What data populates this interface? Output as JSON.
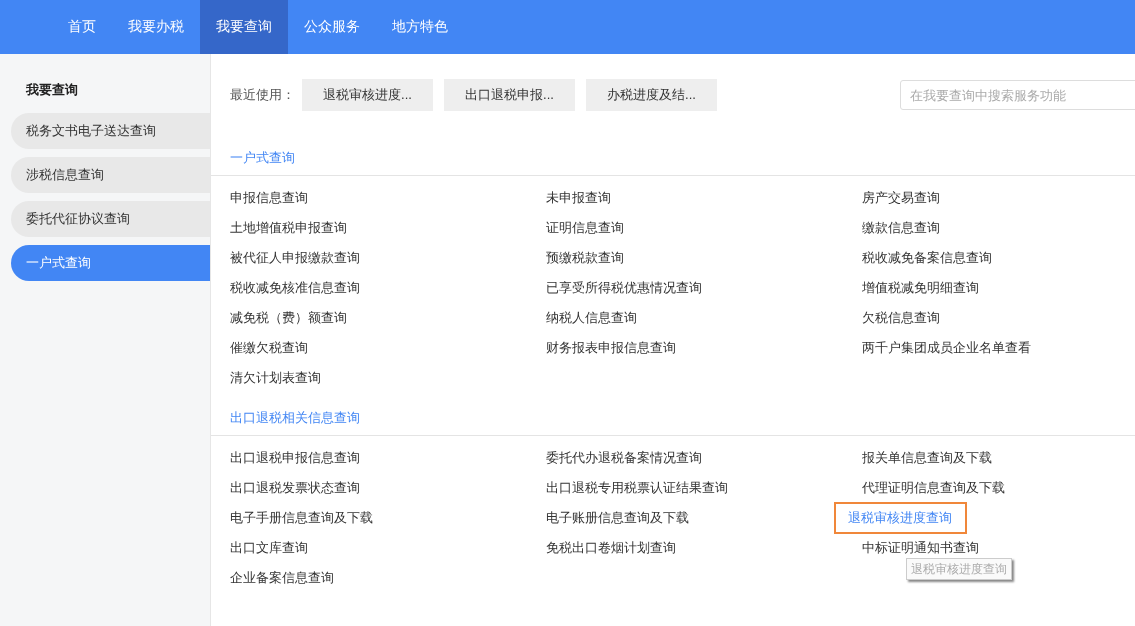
{
  "nav": [
    {
      "label": "首页",
      "selected": false
    },
    {
      "label": "我要办税",
      "selected": false
    },
    {
      "label": "我要查询",
      "selected": true
    },
    {
      "label": "公众服务",
      "selected": false
    },
    {
      "label": "地方特色",
      "selected": false
    }
  ],
  "sidebar": {
    "title": "我要查询",
    "items": [
      {
        "label": "税务文书电子送达查询",
        "selected": false
      },
      {
        "label": "涉税信息查询",
        "selected": false
      },
      {
        "label": "委托代征协议查询",
        "selected": false
      },
      {
        "label": "一户式查询",
        "selected": true
      }
    ]
  },
  "recent": {
    "label": "最近使用：",
    "buttons": [
      "退税审核进度...",
      "出口退税申报...",
      "办税进度及结..."
    ]
  },
  "search": {
    "placeholder": "在我要查询中搜索服务功能"
  },
  "sections": [
    {
      "title": "一户式查询",
      "rows": [
        [
          {
            "label": "申报信息查询",
            "highlighted": false
          },
          {
            "label": "未申报查询",
            "highlighted": false
          },
          {
            "label": "房产交易查询",
            "highlighted": false
          }
        ],
        [
          {
            "label": "土地增值税申报查询",
            "highlighted": false
          },
          {
            "label": "证明信息查询",
            "highlighted": false
          },
          {
            "label": "缴款信息查询",
            "highlighted": false
          }
        ],
        [
          {
            "label": "被代征人申报缴款查询",
            "highlighted": false
          },
          {
            "label": "预缴税款查询",
            "highlighted": false
          },
          {
            "label": "税收减免备案信息查询",
            "highlighted": false
          }
        ],
        [
          {
            "label": "税收减免核准信息查询",
            "highlighted": false
          },
          {
            "label": "已享受所得税优惠情况查询",
            "highlighted": false
          },
          {
            "label": "增值税减免明细查询",
            "highlighted": false
          }
        ],
        [
          {
            "label": "减免税（费）额查询",
            "highlighted": false
          },
          {
            "label": "纳税人信息查询",
            "highlighted": false
          },
          {
            "label": "欠税信息查询",
            "highlighted": false
          }
        ],
        [
          {
            "label": "催缴欠税查询",
            "highlighted": false
          },
          {
            "label": "财务报表申报信息查询",
            "highlighted": false
          },
          {
            "label": "两千户集团成员企业名单查看",
            "highlighted": false
          }
        ],
        [
          {
            "label": "清欠计划表查询",
            "highlighted": false
          }
        ]
      ]
    },
    {
      "title": "出口退税相关信息查询",
      "rows": [
        [
          {
            "label": "出口退税申报信息查询",
            "highlighted": false
          },
          {
            "label": "委托代办退税备案情况查询",
            "highlighted": false
          },
          {
            "label": "报关单信息查询及下载",
            "highlighted": false
          }
        ],
        [
          {
            "label": "出口退税发票状态查询",
            "highlighted": false
          },
          {
            "label": "出口退税专用税票认证结果查询",
            "highlighted": false
          },
          {
            "label": "代理证明信息查询及下载",
            "highlighted": false
          }
        ],
        [
          {
            "label": "电子手册信息查询及下载",
            "highlighted": false
          },
          {
            "label": "电子账册信息查询及下载",
            "highlighted": false
          },
          {
            "label": "退税审核进度查询",
            "highlighted": true,
            "tooltip": "退税审核进度查询"
          }
        ],
        [
          {
            "label": "出口文库查询",
            "highlighted": false
          },
          {
            "label": "免税出口卷烟计划查询",
            "highlighted": false
          },
          {
            "label": "中标证明通知书查询",
            "highlighted": false
          }
        ],
        [
          {
            "label": "企业备案信息查询",
            "highlighted": false
          }
        ]
      ]
    }
  ]
}
